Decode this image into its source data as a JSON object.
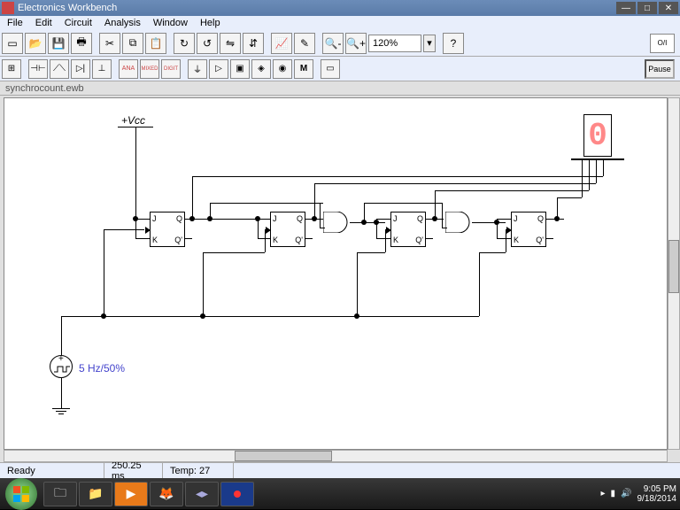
{
  "title": "Electronics Workbench",
  "menu": [
    "File",
    "Edit",
    "Circuit",
    "Analysis",
    "Window",
    "Help"
  ],
  "toolbar1_icons": [
    "new",
    "open",
    "save",
    "print",
    "cut",
    "copy",
    "paste",
    "rotate-cw",
    "rotate-ccw",
    "flip-h",
    "flip-v",
    "graph",
    "probe",
    "zoom-out",
    "zoom-in"
  ],
  "zoom": "120%",
  "help_icon": "?",
  "switch_label": "O/I",
  "toolbar2_icons": [
    "grid",
    "caps",
    "res",
    "diode",
    "trans",
    "ana",
    "mixed",
    "digit",
    "ground",
    "gate",
    "ic",
    "misc",
    "indic",
    "M",
    "meter"
  ],
  "pause_label": "Pause",
  "filetab": "synchrocount.ewb",
  "circuit": {
    "vcc_label": "+Vcc",
    "ff_pins": {
      "j": "J",
      "k": "K",
      "q": "Q",
      "qn": "Q'"
    },
    "seven_seg_value": "0",
    "clock_label": "5 Hz/50%",
    "src_symbol": "+"
  },
  "status": {
    "ready": "Ready",
    "time": "250.25 ms",
    "temp": "Temp:  27"
  },
  "taskbar_apps": [
    "explorer",
    "folder",
    "ie",
    "firefox",
    "vscode",
    "ewb"
  ],
  "tray": {
    "flag": "▸",
    "net": "▮",
    "vol": "🔊",
    "time": "9:05 PM",
    "date": "9/18/2014"
  }
}
